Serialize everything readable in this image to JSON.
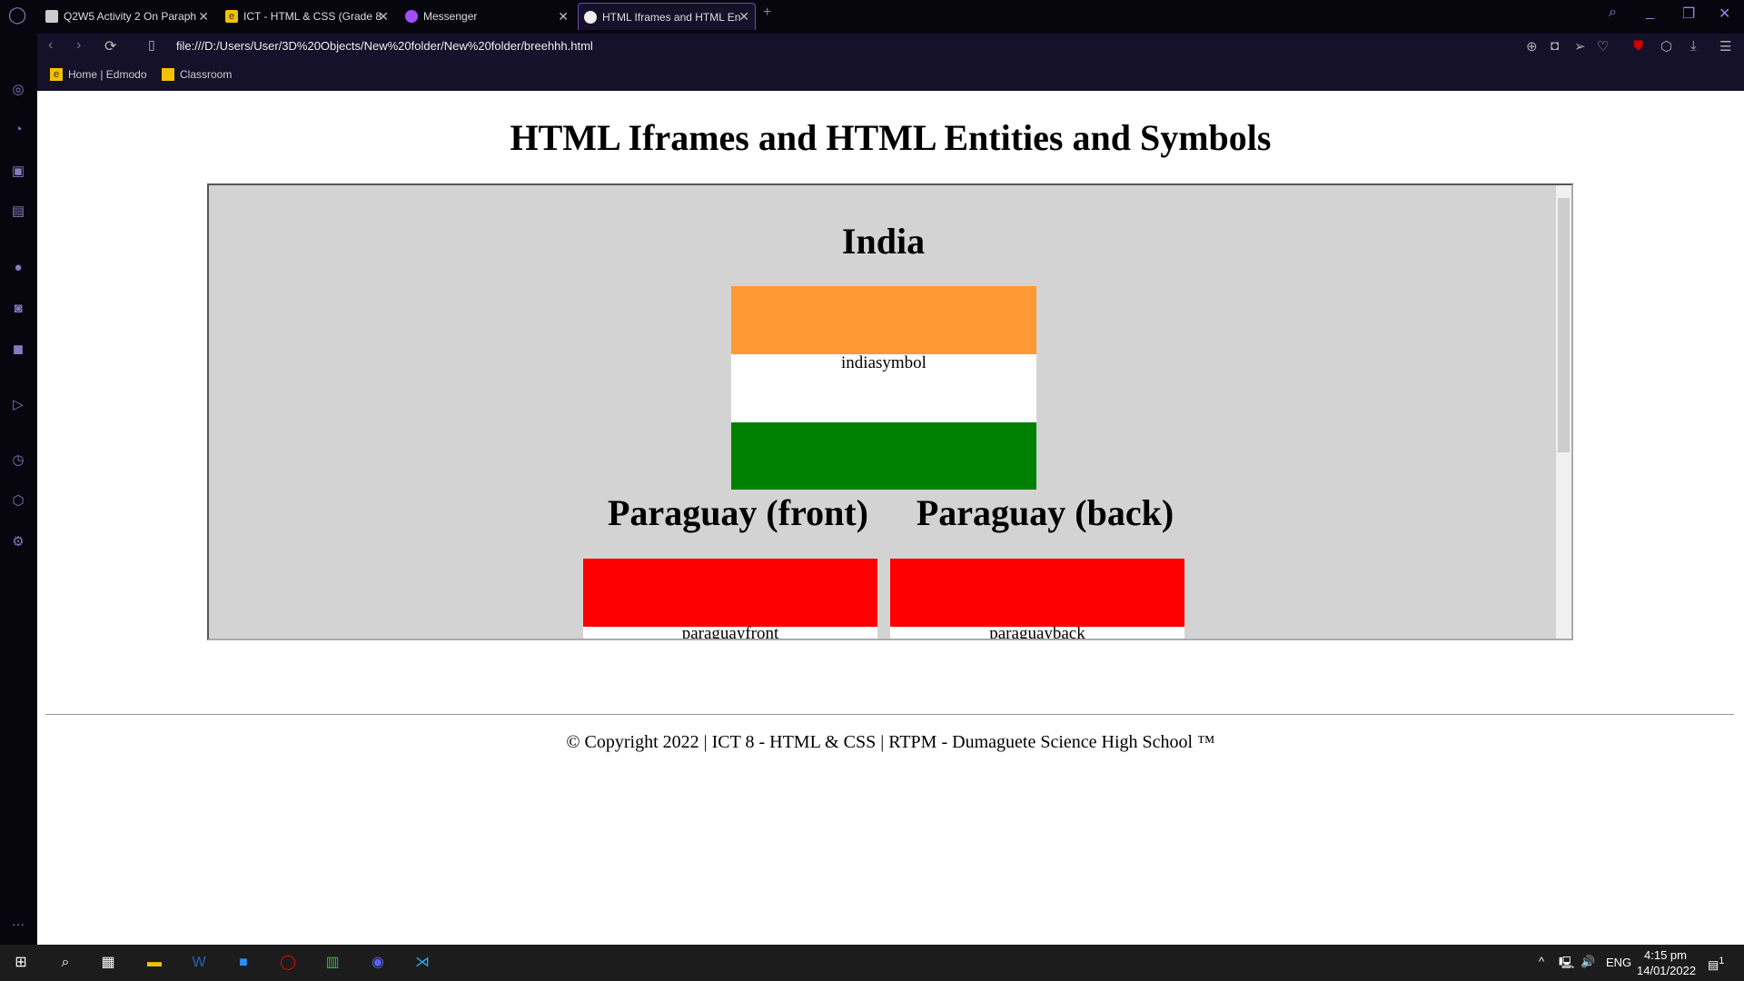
{
  "browser": {
    "tabs": [
      {
        "label": "Q2W5 Activity 2 On Paraph",
        "icon": "document-icon"
      },
      {
        "label": "ICT - HTML & CSS (Grade 8",
        "icon": "edmodo-icon"
      },
      {
        "label": "Messenger",
        "icon": "messenger-icon"
      },
      {
        "label": "HTML Iframes and HTML En",
        "icon": "globe-icon",
        "active": true
      }
    ],
    "url": "file:///D:/Users/User/3D%20Objects/New%20folder/New%20folder/breehhh.html",
    "bookmarks": [
      {
        "label": "Home | Edmodo"
      },
      {
        "label": "Classroom"
      }
    ],
    "accent": "#9b7fe0"
  },
  "page": {
    "title": "HTML Iframes and HTML Entities and Symbols",
    "iframe": {
      "india": {
        "heading": "India",
        "alt": "indiasymbol",
        "colors": [
          "#ff9933",
          "#ffffff",
          "#008000"
        ]
      },
      "paraguay_front": {
        "heading": "Paraguay (front)",
        "alt": "paraguayfront"
      },
      "paraguay_back": {
        "heading": "Paraguay (back)",
        "alt": "paraguayback"
      }
    },
    "footer": "© Copyright 2022 | ICT 8 - HTML & CSS | RTPM - Dumaguete Science High School ™"
  },
  "taskbar": {
    "time": "4:15 pm",
    "date": "14/01/2022",
    "lang": "ENG",
    "notifications": "1"
  }
}
